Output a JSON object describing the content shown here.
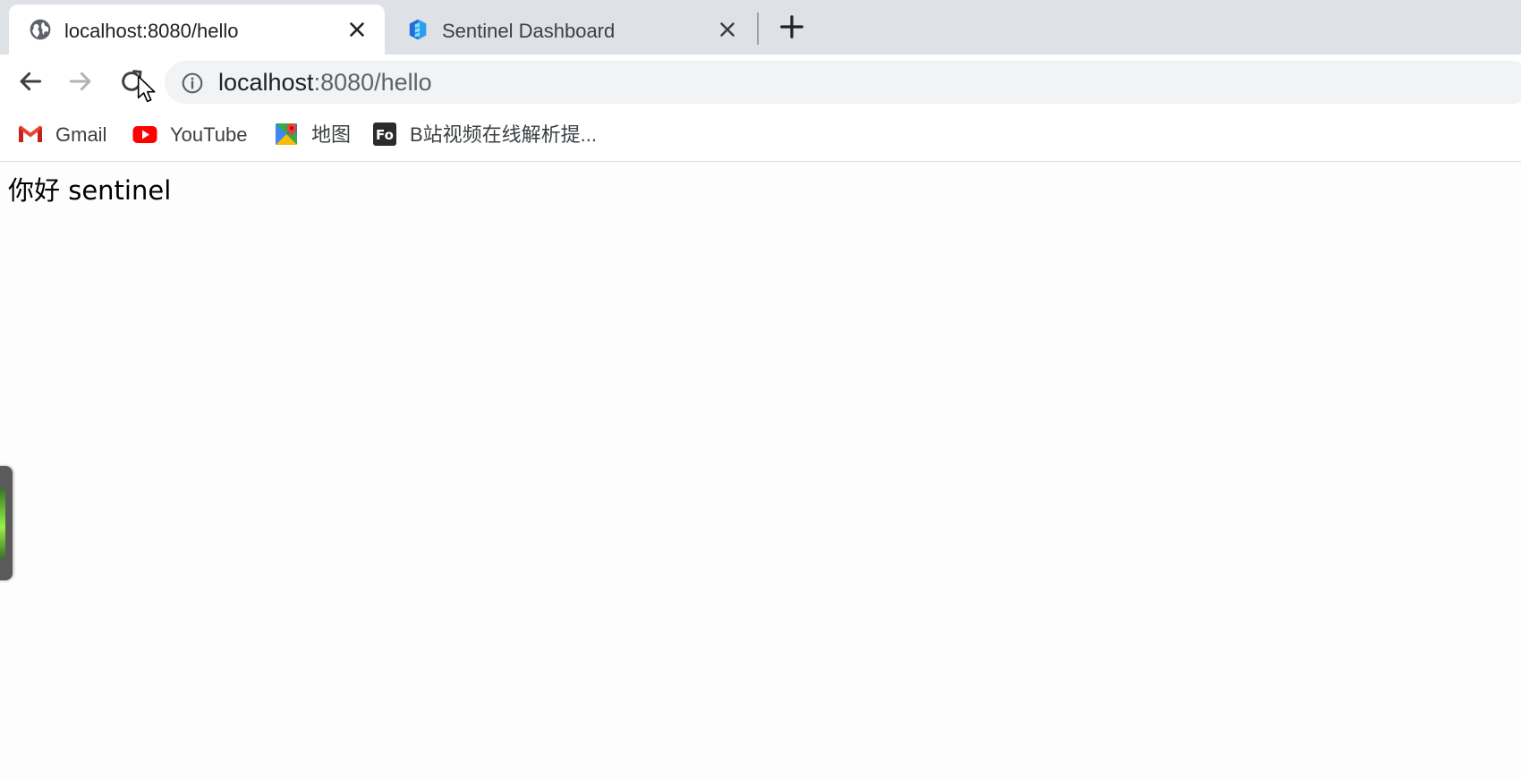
{
  "tabs": [
    {
      "title": "localhost:8080/hello",
      "active": true,
      "favicon": "globe-icon"
    },
    {
      "title": "Sentinel Dashboard",
      "active": false,
      "favicon": "sentinel-logo-icon"
    }
  ],
  "toolbar": {
    "back_icon": "arrow-left-icon",
    "forward_icon": "arrow-right-icon",
    "reload_icon": "reload-icon",
    "new_tab_icon": "plus-icon"
  },
  "omnibox": {
    "url_host": "localhost",
    "url_rest": ":8080/hello",
    "info_icon": "info-icon"
  },
  "bookmarks": [
    {
      "label": "Gmail",
      "icon": "gmail-icon"
    },
    {
      "label": "YouTube",
      "icon": "youtube-icon"
    },
    {
      "label": "地图",
      "icon": "maps-icon"
    },
    {
      "label": "B站视频在线解析提...",
      "icon": "fo-icon"
    }
  ],
  "page": {
    "greeting": "你好 sentinel"
  },
  "colors": {
    "tabstrip_bg": "#dee1e6",
    "omnibox_bg": "#f1f3f4",
    "youtube_red": "#ff0000",
    "side_widget_green": "#7de03b"
  }
}
